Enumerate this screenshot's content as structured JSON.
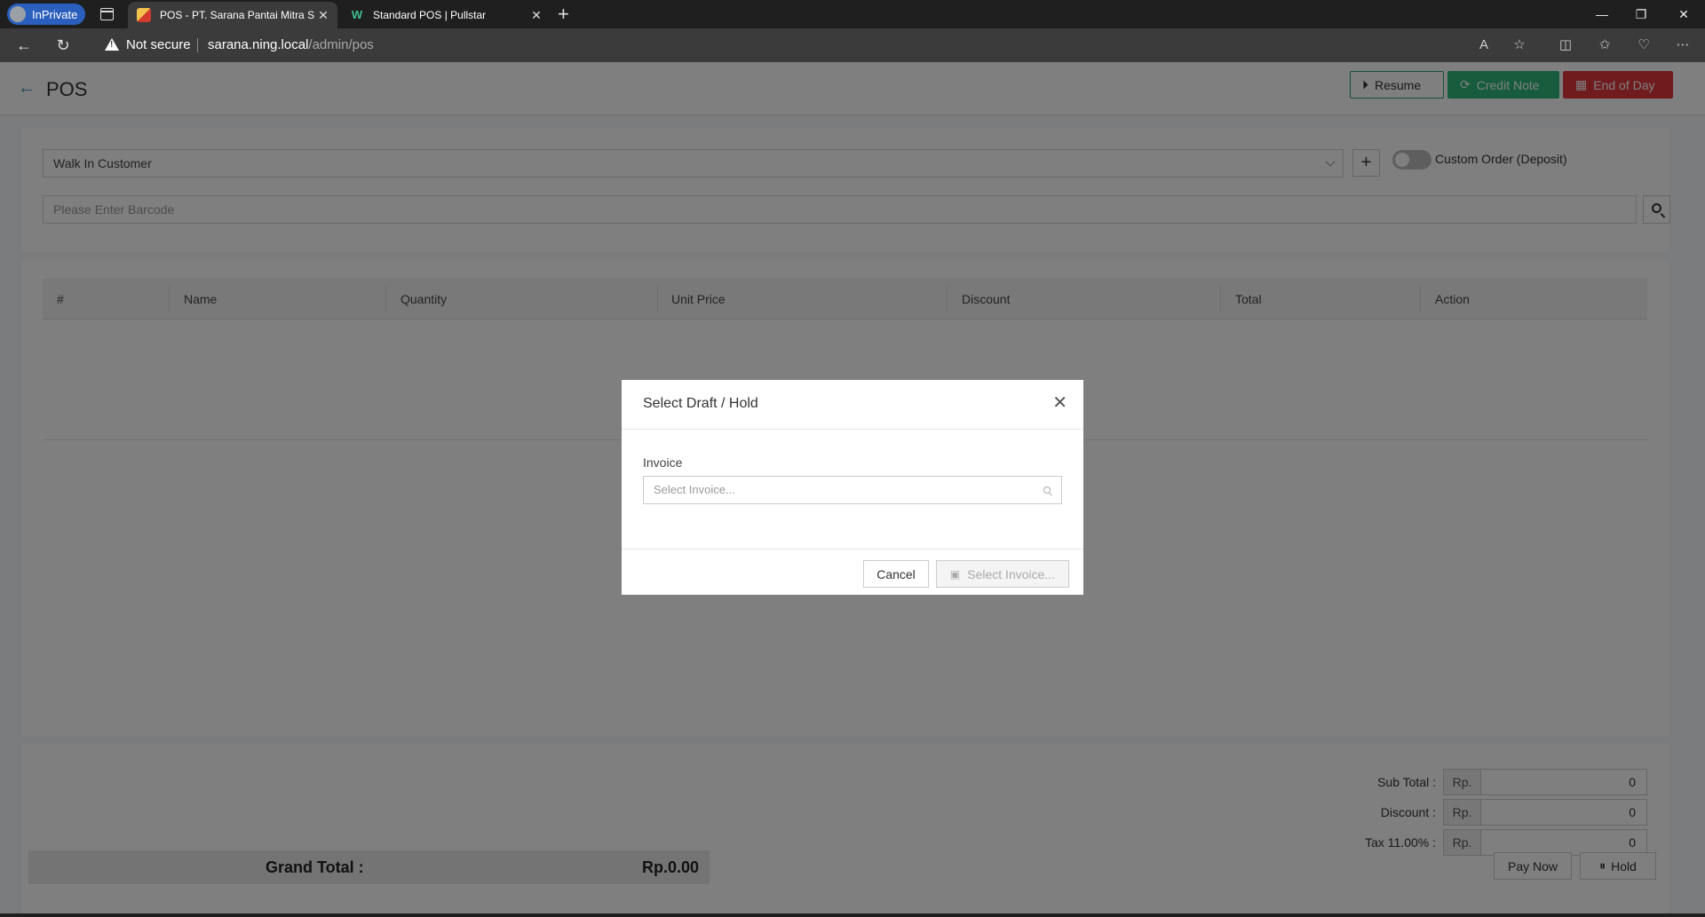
{
  "browser": {
    "inprivate_label": "InPrivate",
    "tabs": [
      {
        "title": "POS - PT. Sarana Pantai Mitra Se",
        "active": true
      },
      {
        "title": "Standard POS | Pullstar",
        "active": false
      }
    ],
    "address": {
      "security": "Not secure",
      "host": "sarana.ning.local",
      "path": "/admin/pos"
    }
  },
  "header": {
    "title": "POS",
    "resume_label": "Resume",
    "credit_note_label": "Credit Note",
    "end_of_day_label": "End of Day",
    "colors": {
      "credit_note": "#2fb87a",
      "end_of_day": "#e0393e"
    }
  },
  "customer": {
    "selected": "Walk In Customer",
    "custom_order_label": "Custom Order (Deposit)",
    "custom_order_on": false,
    "barcode_placeholder": "Please Enter Barcode"
  },
  "table": {
    "columns": [
      "#",
      "Name",
      "Quantity",
      "Unit Price",
      "Discount",
      "Total",
      "Action"
    ],
    "rows": []
  },
  "totals": {
    "currency_prefix": "Rp.",
    "sub_total_label": "Sub Total :",
    "sub_total": "0",
    "discount_label": "Discount :",
    "discount": "0",
    "tax_label": "Tax 11.00% :",
    "tax": "0",
    "grand_total_label": "Grand Total :",
    "grand_total": "Rp.0.00",
    "pay_now_label": "Pay Now",
    "hold_label": "Hold"
  },
  "modal": {
    "title": "Select Draft / Hold",
    "invoice_label": "Invoice",
    "invoice_placeholder": "Select Invoice...",
    "cancel_label": "Cancel",
    "select_label": "Select Invoice..."
  }
}
